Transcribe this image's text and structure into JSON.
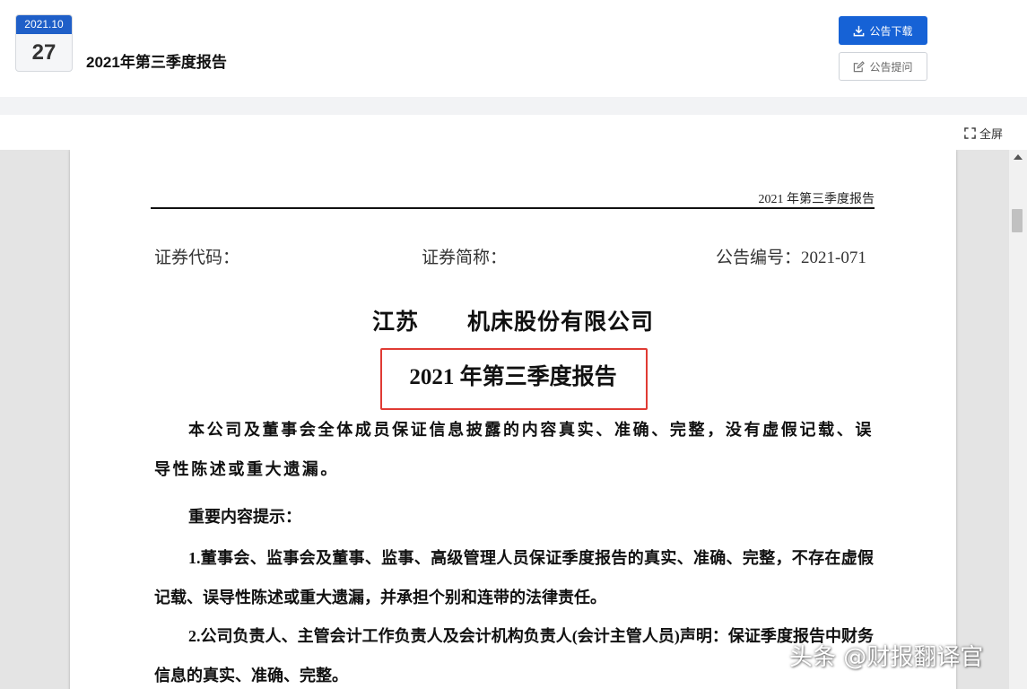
{
  "header": {
    "date": {
      "year_month": "2021.10",
      "day": "27"
    },
    "title": "2021年第三季度报告",
    "download_label": "公告下载",
    "ask_label": "公告提问",
    "accent_color": "#1662d6"
  },
  "toolbar": {
    "fullscreen_label": "全屏"
  },
  "document": {
    "running_head": "2021 年第三季度报告",
    "security_code": "证券代码：",
    "security_abbr": "证券简称：",
    "announcement_no": "公告编号：2021-071",
    "company_prefix": "江苏",
    "company_suffix": "机床股份有限公司",
    "report_title": "2021 年第三季度报告",
    "highlight_color": "#e03b34",
    "statement": "本公司及董事会全体成员保证信息披露的内容真实、准确、完整，没有虚假记载、误导性陈述或重大遗漏。",
    "tips_heading": "重要内容提示：",
    "item_1": "1.董事会、监事会及董事、监事、高级管理人员保证季度报告的真实、准确、完整，不存在虚假记载、误导性陈述或重大遗漏，并承担个别和连带的法律责任。",
    "item_2": "2.公司负责人、主管会计工作负责人及会计机构负责人(会计主管人员)声明：保证季度报告中财务信息的真实、准确、完整。"
  },
  "watermark": "头条 @财报翻译官"
}
